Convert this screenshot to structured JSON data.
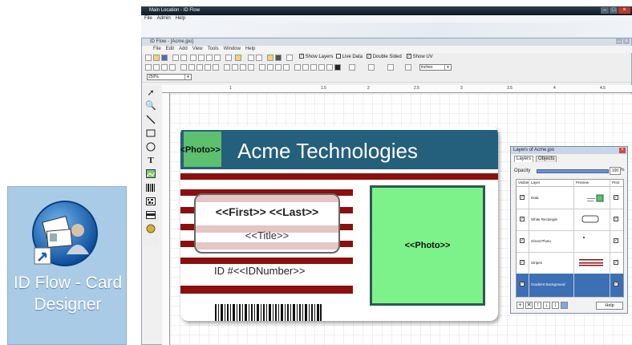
{
  "shortcut": {
    "label": "ID Flow - Card Designer",
    "icon": "id-flow-app-icon"
  },
  "outer_window": {
    "title": "Main Location - ID Flow",
    "menus": [
      "File",
      "Admin",
      "Help"
    ]
  },
  "app_window": {
    "title": "ID Flow - [Acme.jpo]",
    "menus": [
      "File",
      "Edit",
      "Add",
      "View",
      "Tools",
      "Window",
      "Help"
    ]
  },
  "toolbar": {
    "show_layers": "Show Layers",
    "live_data": "Live Data",
    "double_sided": "Double Sided",
    "show_uv": "Show UV",
    "units": "inches",
    "zoom": "250%"
  },
  "ruler": {
    "marks": [
      "1",
      "1.5",
      "2",
      "2.5",
      "3",
      "3.5",
      "4",
      "4.5"
    ]
  },
  "card": {
    "company": "Acme Technologies",
    "photo_small": "<<Photo>>",
    "first_last": "<<First>> <<Last>>",
    "title_field": "<<Title>>",
    "id_number": "ID #<<IDNumber>>",
    "photo_big": "<<Photo>>",
    "colors": {
      "banner": "#245f7c",
      "stripe": "#8b0f0f",
      "photo_fill": "#7ef28a"
    }
  },
  "layers_panel": {
    "title": "Layers of Acme.jpo",
    "tabs": [
      "Layers",
      "Objects"
    ],
    "opacity_label": "Opacity",
    "opacity_value": "100",
    "opacity_unit": "%",
    "columns": [
      "Visible",
      "Layer",
      "Preview",
      "Print"
    ],
    "layers": [
      {
        "name": "Data",
        "selected": false
      },
      {
        "name": "White Rectangle",
        "selected": false
      },
      {
        "name": "Ghost Photo",
        "selected": false
      },
      {
        "name": "Stripes",
        "selected": false
      },
      {
        "name": "Gradient Background",
        "selected": true
      }
    ],
    "buttons": [
      "+",
      "✕",
      "↑",
      "↓",
      "↕"
    ],
    "help_label": "Help"
  }
}
